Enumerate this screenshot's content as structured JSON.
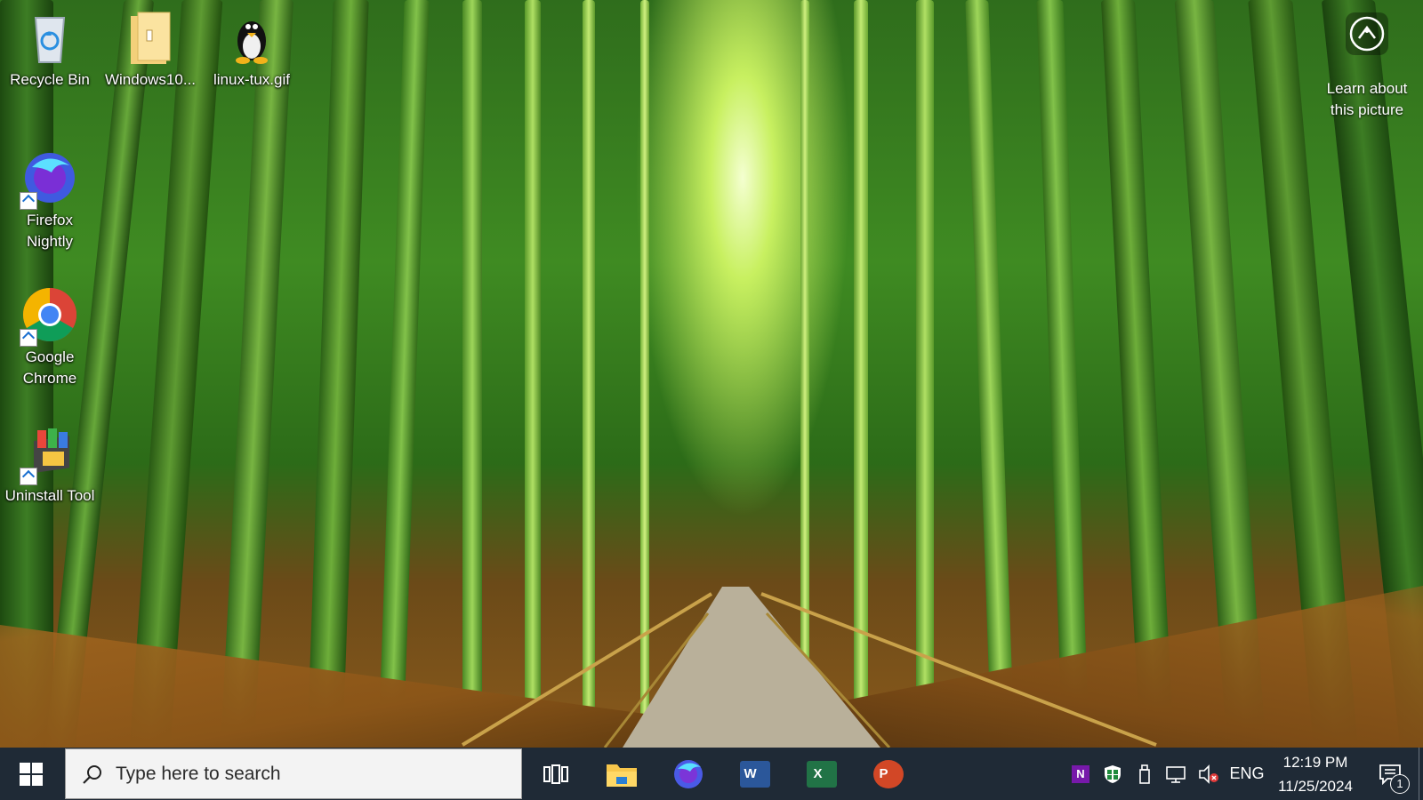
{
  "desktop": {
    "icons": [
      {
        "label": "Recycle Bin",
        "icon": "recycle-bin-icon"
      },
      {
        "label": "Windows10...",
        "icon": "folder-icon"
      },
      {
        "label": "linux-tux.gif",
        "icon": "tux-penguin-icon"
      },
      {
        "label": "Firefox Nightly",
        "icon": "firefox-nightly-icon"
      },
      {
        "label": "Google Chrome",
        "icon": "chrome-icon"
      },
      {
        "label": "Uninstall Tool",
        "icon": "uninstall-tool-icon"
      }
    ],
    "learn_about": {
      "line1": "Learn about",
      "line2": "this picture",
      "icon": "camera-icon"
    }
  },
  "taskbar": {
    "start_icon": "windows-logo-icon",
    "search": {
      "placeholder": "Type here to search",
      "icon": "search-icon"
    },
    "pinned": [
      {
        "name": "Task View",
        "icon": "task-view-icon"
      },
      {
        "name": "File Explorer",
        "icon": "file-explorer-icon"
      },
      {
        "name": "Firefox",
        "icon": "firefox-icon"
      },
      {
        "name": "Word",
        "icon": "word-icon",
        "letter": "W"
      },
      {
        "name": "Excel",
        "icon": "excel-icon",
        "letter": "X"
      },
      {
        "name": "PowerPoint",
        "icon": "powerpoint-icon",
        "letter": "P"
      }
    ],
    "tray": {
      "icons": [
        "onenote-icon",
        "windows-security-icon",
        "usb-device-icon",
        "network-icon",
        "volume-muted-icon"
      ],
      "language": "ENG",
      "time": "12:19 PM",
      "date": "11/25/2024",
      "notification_count": "1"
    }
  },
  "colors": {
    "taskbar": "#1f2a36",
    "word": "#2b579a",
    "excel": "#217346",
    "powerpoint": "#d24726",
    "onenote": "#7719aa"
  }
}
